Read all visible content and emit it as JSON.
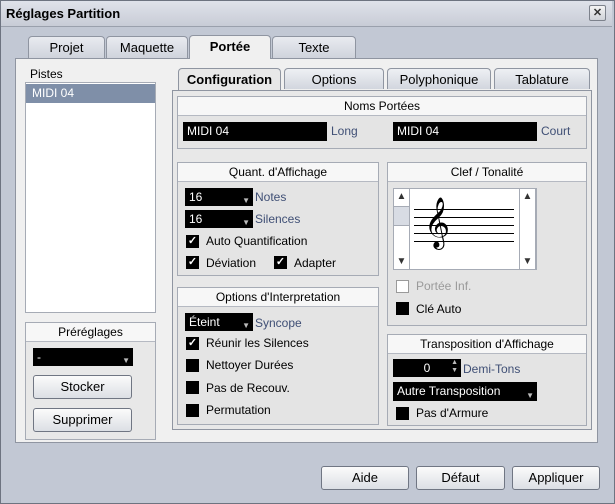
{
  "window": {
    "title": "Réglages Partition"
  },
  "main_tabs": [
    "Projet",
    "Maquette",
    "Portée",
    "Texte"
  ],
  "pistes": {
    "label": "Pistes",
    "items": [
      "MIDI 04"
    ]
  },
  "presets": {
    "title": "Préréglages",
    "value": "-",
    "store_label": "Stocker",
    "delete_label": "Supprimer"
  },
  "sub_tabs": [
    "Configuration",
    "Options",
    "Polyphonique",
    "Tablature"
  ],
  "noms_portees": {
    "title": "Noms Portées",
    "long_value": "MIDI 04",
    "long_label": "Long",
    "court_value": "MIDI 04",
    "court_label": "Court"
  },
  "quant": {
    "title": "Quant. d'Affichage",
    "notes_value": "16",
    "notes_label": "Notes",
    "silences_value": "16",
    "silences_label": "Silences",
    "auto_label": "Auto Quantification",
    "deviation_label": "Déviation",
    "adapter_label": "Adapter"
  },
  "clef": {
    "title": "Clef / Tonalité",
    "portee_inf_label": "Portée Inf.",
    "cle_auto_label": "Clé Auto"
  },
  "interp": {
    "title": "Options d'Interpretation",
    "syncope_value": "Éteint",
    "syncope_label": "Syncope",
    "reunir_label": "Réunir les Silences",
    "nettoyer_label": "Nettoyer Durées",
    "recouv_label": "Pas de Recouv.",
    "perm_label": "Permutation"
  },
  "transp": {
    "title": "Transposition d'Affichage",
    "value": "0",
    "unit_label": "Demi-Tons",
    "mode_value": "Autre Transposition",
    "armure_label": "Pas d'Armure"
  },
  "footer": {
    "help_label": "Aide",
    "default_label": "Défaut",
    "apply_label": "Appliquer"
  }
}
